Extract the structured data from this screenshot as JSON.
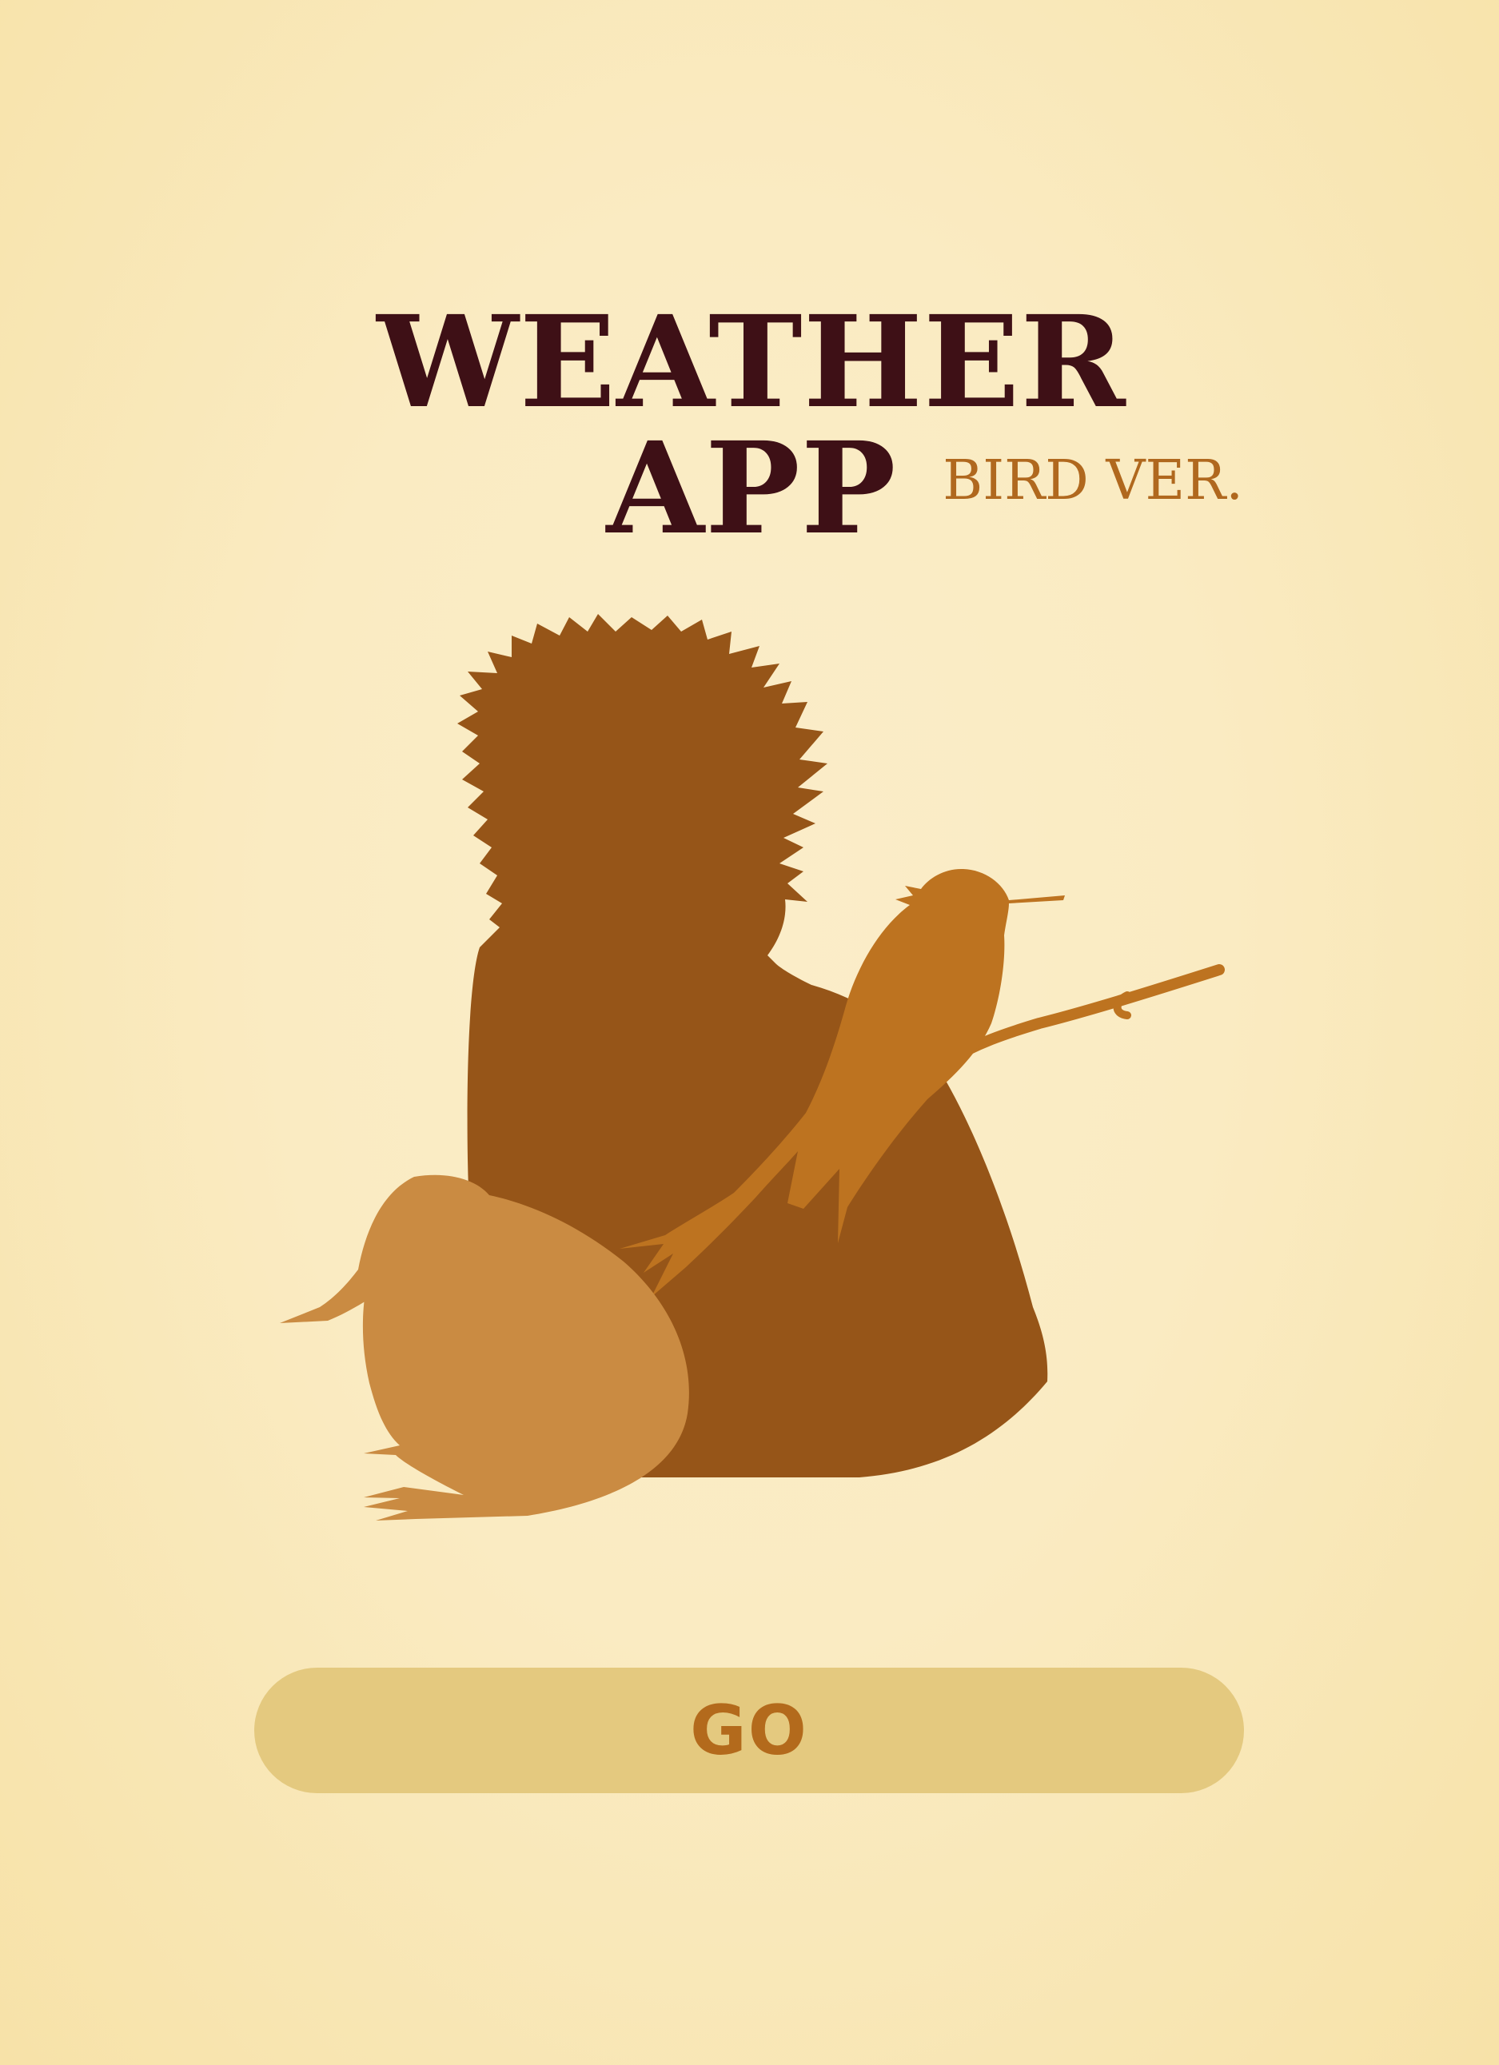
{
  "app": {
    "title": "WEATHER APP",
    "subtitle": "BIRD VER."
  },
  "illustration": {
    "icons": [
      "rooster-silhouette-icon",
      "kiwi-silhouette-icon",
      "hummingbird-on-branch-icon"
    ],
    "colors": {
      "rooster": "#965518",
      "kiwi": "#ca8b42",
      "hummingbird": "#bd7320",
      "branch": "#bd7320"
    }
  },
  "action": {
    "go_label": "GO"
  },
  "colors": {
    "background": "#faebc2",
    "title": "#3e1016",
    "subtitle": "#b0681e",
    "button_bg": "#e4c97f",
    "button_text": "#b36a1c"
  }
}
